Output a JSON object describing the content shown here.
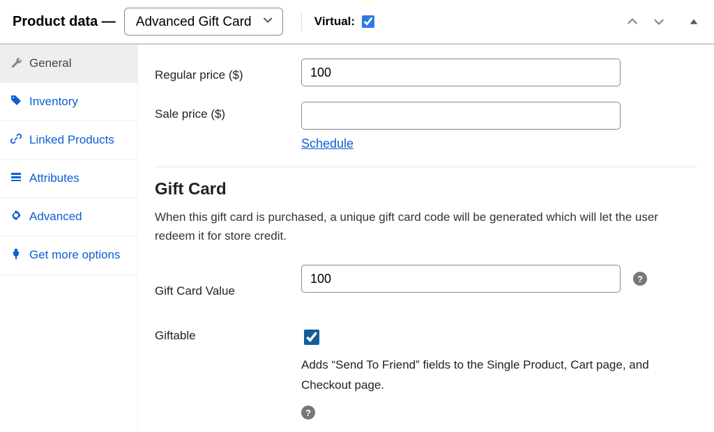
{
  "header": {
    "title": "Product data —",
    "product_type": "Advanced Gift Card",
    "virtual_label": "Virtual:",
    "virtual_checked": true
  },
  "sidebar": {
    "tabs": [
      {
        "id": "general",
        "label": "General",
        "icon": "wrench-icon",
        "active": true
      },
      {
        "id": "inventory",
        "label": "Inventory",
        "icon": "tag-icon",
        "active": false
      },
      {
        "id": "linked",
        "label": "Linked Products",
        "icon": "link-icon",
        "active": false
      },
      {
        "id": "attributes",
        "label": "Attributes",
        "icon": "list-icon",
        "active": false
      },
      {
        "id": "advanced",
        "label": "Advanced",
        "icon": "gear-icon",
        "active": false
      },
      {
        "id": "getmore",
        "label": "Get more options",
        "icon": "plug-icon",
        "active": false
      }
    ]
  },
  "general": {
    "regular_price_label": "Regular price ($)",
    "regular_price_value": "100",
    "sale_price_label": "Sale price ($)",
    "sale_price_value": "",
    "schedule_link": "Schedule"
  },
  "gift_card": {
    "heading": "Gift Card",
    "description": "When this gift card is purchased, a unique gift card code will be generated which will let the user redeem it for store credit.",
    "value_label": "Gift Card Value",
    "value": "100",
    "giftable_label": "Giftable",
    "giftable_checked": true,
    "giftable_desc": "Adds “Send To Friend” fields to the Single Product, Cart page, and Checkout page."
  }
}
